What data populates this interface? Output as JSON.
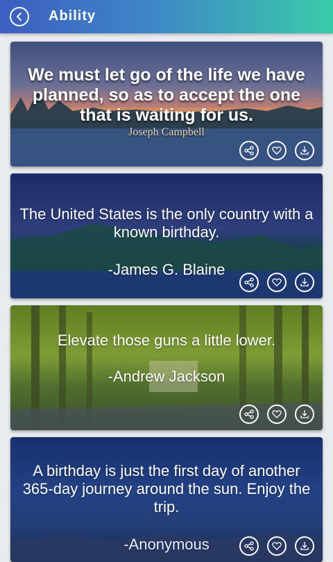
{
  "header": {
    "title": "Ability",
    "back_icon": "chevron-left-icon"
  },
  "cards": [
    {
      "quote": "We must let go of the life we have planned, so as to accept the one that is waiting for us.",
      "author": "Joseph Campbell"
    },
    {
      "quote": "The United States is the only country with a known birthday.",
      "author": "-James G. Blaine"
    },
    {
      "quote": "Elevate those guns a little lower.",
      "author": "-Andrew Jackson"
    },
    {
      "quote": "A birthday is just the first day of another 365-day journey around the sun. Enjoy the trip.",
      "author": "-Anonymous"
    }
  ],
  "icons": {
    "share": "share-icon",
    "favorite": "heart-icon",
    "download": "download-icon"
  },
  "colors": {
    "header_start": "#3c5ec0",
    "header_end": "#39cba7"
  }
}
